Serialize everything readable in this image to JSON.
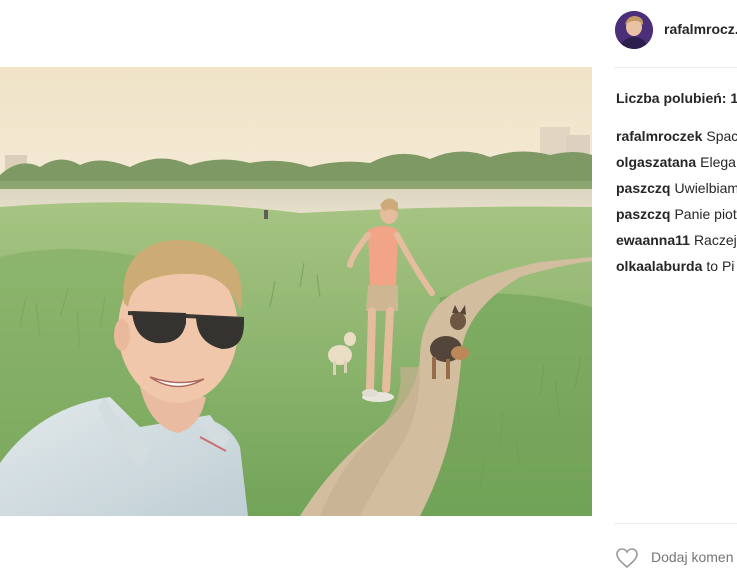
{
  "post": {
    "username": "rafalmrocz...",
    "likes_label": "Liczba polubień: 1",
    "comments": [
      {
        "user": "rafalmroczek",
        "text": "Spac"
      },
      {
        "user": "olgaszatana",
        "text": "Elega"
      },
      {
        "user": "paszczq",
        "text": "Uwielbiam"
      },
      {
        "user": "paszczq",
        "text": "Panie piot"
      },
      {
        "user": "ewaanna11",
        "text": "Raczej"
      },
      {
        "user": "olkaalaburda",
        "text": "to Pi"
      }
    ],
    "add_comment_placeholder": "Dodaj komen",
    "icons": {
      "like": "heart-outline-icon"
    }
  }
}
